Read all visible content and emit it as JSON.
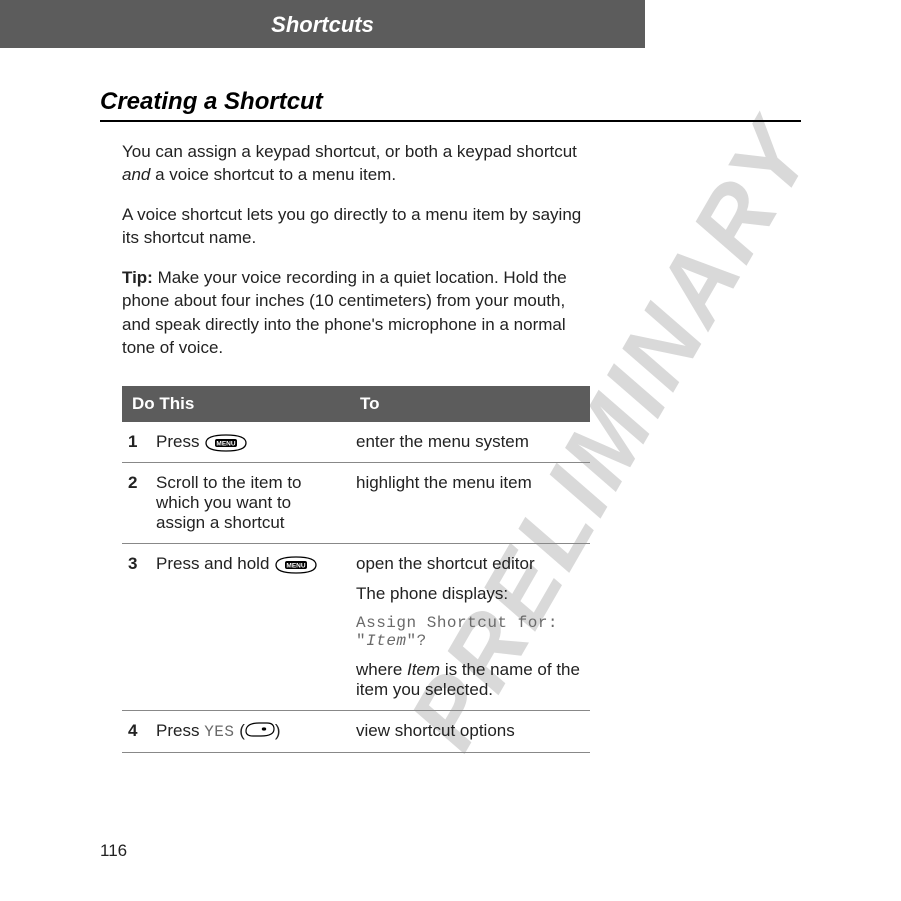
{
  "header": {
    "title": "Shortcuts"
  },
  "section": {
    "title": "Creating a Shortcut"
  },
  "paragraphs": {
    "p1a": "You can assign a keypad shortcut, or both a keypad shortcut ",
    "p1_and": "and",
    "p1b": " a voice shortcut to a menu item.",
    "p2": "A voice shortcut lets you go directly to a menu item by saying its shortcut name.",
    "p3_tip": "Tip:",
    "p3_body": " Make your voice recording in a quiet location. Hold the phone about four inches (10 centimeters) from your mouth, and speak directly into the phone's microphone in a normal tone of voice."
  },
  "table": {
    "head": {
      "do": "Do This",
      "to": "To"
    },
    "rows": [
      {
        "idx": "1",
        "do_a": "Press ",
        "to": "enter the menu system"
      },
      {
        "idx": "2",
        "do": "Scroll to the item to which you want to assign a shortcut",
        "to": "highlight the menu item"
      },
      {
        "idx": "3",
        "do_a": "Press and hold ",
        "to_a": "open the shortcut editor",
        "to_b": "The phone displays:",
        "to_code": "Assign Shortcut for:",
        "to_code2a": "\"",
        "to_code2_item": "Item",
        "to_code2b": "\"?",
        "to_d_a": "where ",
        "to_d_item": "Item",
        "to_d_b": " is the name of the item you selected."
      },
      {
        "idx": "4",
        "do_a": "Press ",
        "do_yes": "YES",
        "do_b": " (",
        "do_c": ")",
        "to": "view shortcut options"
      }
    ]
  },
  "watermark": "PRELIMINARY",
  "page_number": "116",
  "icons": {
    "menu_label": "MENU"
  }
}
